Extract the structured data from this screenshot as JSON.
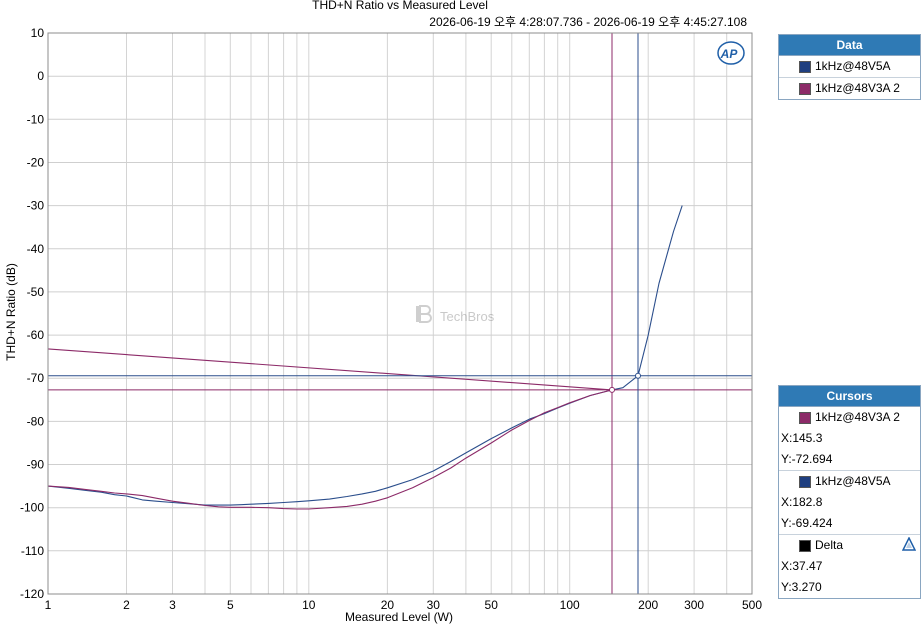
{
  "chart_data": {
    "type": "line",
    "title": "THD+N Ratio vs Measured Level",
    "subtitle": "2026-06-19 오후 4:28:07.736 - 2026-06-19 오후 4:45:27.108",
    "xlabel": "Measured Level (W)",
    "ylabel": "THD+N Ratio (dB)",
    "x_scale": "log",
    "xlim": [
      1,
      500
    ],
    "ylim": [
      -120,
      10
    ],
    "x_ticks": [
      1,
      2,
      3,
      5,
      10,
      20,
      30,
      50,
      100,
      200,
      300,
      500
    ],
    "x_tick_labels": [
      "1",
      "2",
      "3",
      "5",
      "10",
      "20",
      "30",
      "50",
      "100",
      "200",
      "300",
      "500"
    ],
    "y_ticks": [
      10,
      0,
      -10,
      -20,
      -30,
      -40,
      -50,
      -60,
      -70,
      -80,
      -90,
      -100,
      -110,
      -120
    ],
    "y_tick_labels": [
      "10",
      "0",
      "-10",
      "-20",
      "-30",
      "-40",
      "-50",
      "-60",
      "-70",
      "-80",
      "-90",
      "-100",
      "-110",
      "-120"
    ],
    "grid": true,
    "legend_position": "right",
    "series": [
      {
        "name": "1kHz@48V5A",
        "color": "#2b4e8c",
        "x": [
          1,
          1.2,
          1.4,
          1.6,
          1.8,
          2.0,
          2.3,
          2.6,
          3.0,
          3.5,
          4.0,
          4.5,
          5.0,
          5.5,
          6.0,
          7.0,
          8.0,
          9.0,
          10,
          12,
          14,
          16,
          18,
          20,
          25,
          30,
          35,
          40,
          50,
          60,
          70,
          80,
          90,
          100,
          120,
          145.3,
          160,
          182.8,
          200,
          220,
          250,
          270
        ],
        "y": [
          -95,
          -95.5,
          -96,
          -96.4,
          -97,
          -97.3,
          -98.2,
          -98.5,
          -98.8,
          -99.1,
          -99.4,
          -99.4,
          -99.4,
          -99.3,
          -99.2,
          -99,
          -98.8,
          -98.6,
          -98.4,
          -98,
          -97.4,
          -96.8,
          -96.2,
          -95.4,
          -93.5,
          -91.5,
          -89.3,
          -87.3,
          -84,
          -81.5,
          -79.5,
          -78.2,
          -76.9,
          -75.8,
          -74,
          -72.694,
          -72.2,
          -69.424,
          -60,
          -48,
          -36,
          -30
        ]
      },
      {
        "name": "1kHz@48V3A 2",
        "color": "#8c2a68",
        "x": [
          1,
          1.2,
          1.4,
          1.6,
          1.8,
          2.0,
          2.3,
          2.6,
          3.0,
          3.5,
          4.0,
          4.5,
          5.0,
          5.5,
          6.0,
          7.0,
          8.0,
          9.0,
          10,
          12,
          14,
          16,
          18,
          20,
          25,
          30,
          35,
          40,
          50,
          60,
          70,
          80,
          90,
          100,
          120,
          145.3,
          1
        ],
        "y": [
          -95,
          -95.3,
          -95.8,
          -96.2,
          -96.6,
          -96.8,
          -97.2,
          -97.8,
          -98.5,
          -99,
          -99.5,
          -99.8,
          -99.9,
          -99.9,
          -99.9,
          -100,
          -100.2,
          -100.3,
          -100.3,
          -100,
          -99.7,
          -99.2,
          -98.5,
          -97.7,
          -95.4,
          -93,
          -90.8,
          -88.5,
          -85,
          -82,
          -79.8,
          -78,
          -76.8,
          -75.7,
          -74,
          -72.694,
          -63.2
        ]
      }
    ],
    "cursors": [
      {
        "series": "1kHz@48V3A 2",
        "x": 145.3,
        "y": -72.694,
        "color": "#8c2a68"
      },
      {
        "series": "1kHz@48V5A",
        "x": 182.8,
        "y": -69.424,
        "color": "#2b4e8c"
      }
    ]
  },
  "data_panel": {
    "title": "Data",
    "items": [
      {
        "label": "1kHz@48V5A",
        "color": "#1f3f80"
      },
      {
        "label": "1kHz@48V3A 2",
        "color": "#8c2a68"
      }
    ]
  },
  "cursors_panel": {
    "title": "Cursors",
    "entries": [
      {
        "label": "1kHz@48V3A 2",
        "color": "#8c2a68",
        "x_text": "X:145.3",
        "y_text": "Y:-72.694"
      },
      {
        "label": "1kHz@48V5A",
        "color": "#1f3f80",
        "x_text": "X:182.8",
        "y_text": "Y:-69.424"
      }
    ],
    "delta": {
      "label": "Delta",
      "color": "#000000",
      "x_text": "X:37.47",
      "y_text": "Y:3.270"
    }
  },
  "watermark": "TechBros",
  "logo_text": "AP"
}
